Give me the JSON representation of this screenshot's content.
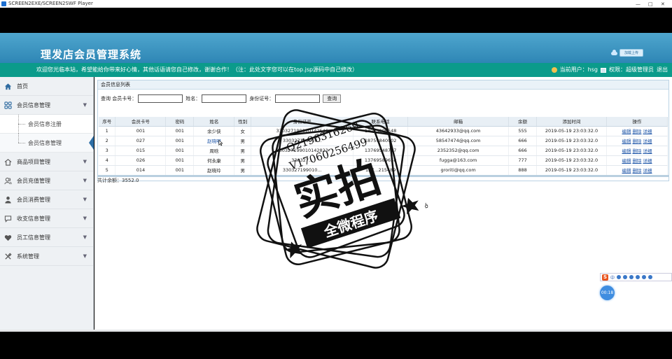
{
  "window": {
    "title": "SCREEN2EXE/SCREEN2SWF Player",
    "controls": [
      "—",
      "□",
      "✕"
    ]
  },
  "header": {
    "system_title": "理发店会员管理系统",
    "upload_label": "加载上传"
  },
  "welcome": {
    "text": "欢迎您光临本站，希望能给你带来好心情，其他话语请您自己修改，谢谢合作！（注：此处文字您可以在top.jsp源码中自己修改）",
    "current_user_label": "当前用户：hsg",
    "permission_label": "权限：超级管理员",
    "logout_label": "退出"
  },
  "sidebar": {
    "home": "首页",
    "member_info_management": "会员信息管理",
    "member_info_register": "会员信息注册",
    "member_info_manage": "会员信息管理",
    "product_item_management": "商品项目管理",
    "member_recharge_management": "会员充值管理",
    "member_consume_management": "会员消费管理",
    "income_expense_management": "收支信息管理",
    "staff_info_management": "员工信息管理",
    "system_management": "系统管理"
  },
  "panel": {
    "title": "会员信息列表",
    "search_label": "查询",
    "card_no_label": "会员卡号：",
    "name_label": "姓名：",
    "id_no_label": "身份证号：",
    "query_button": "查询",
    "balance_total": "共计余额：3552.0"
  },
  "table": {
    "headers": [
      "序号",
      "会员卡号",
      "密码",
      "姓名",
      "性别",
      "身份证号",
      "联系电话",
      "邮箱",
      "余额",
      "添加时间",
      "操作"
    ],
    "ops": [
      "编辑",
      "删除",
      "详细"
    ],
    "rows": [
      [
        "1",
        "001",
        "001",
        "余少侠",
        "女",
        "330327199010142546",
        "13025896548",
        "43642933@qq.com",
        "555",
        "2019-05-19 23:03:32.0"
      ],
      [
        "2",
        "027",
        "001",
        "赵晓明",
        "男",
        "330327199010...",
        "18759840002",
        "58547474@qq.com",
        "666",
        "2019-05-19 23:03:32.0"
      ],
      [
        "3",
        "015",
        "001",
        "周晗",
        "男",
        "330327199010142823",
        "13769548717",
        "2352352@qq.com",
        "666",
        "2019-05-19 23:03:32.0"
      ],
      [
        "4",
        "026",
        "001",
        "何永康",
        "男",
        "330327...",
        "13769589658",
        "fugga@163.com",
        "777",
        "2019-05-19 23:03:32.0"
      ],
      [
        "5",
        "014",
        "001",
        "赵晓玲",
        "男",
        "330327199010...",
        "137...215489",
        "groriti@qq.com",
        "888",
        "2019-05-19 23:03:32.0"
      ]
    ]
  },
  "watermark": {
    "line1": "Q2196316269",
    "line2": "V17060256499",
    "main": "实拍",
    "sub": "全微程序"
  },
  "ime": {
    "logo": "S",
    "lang": "中"
  },
  "timer": "00:18"
}
